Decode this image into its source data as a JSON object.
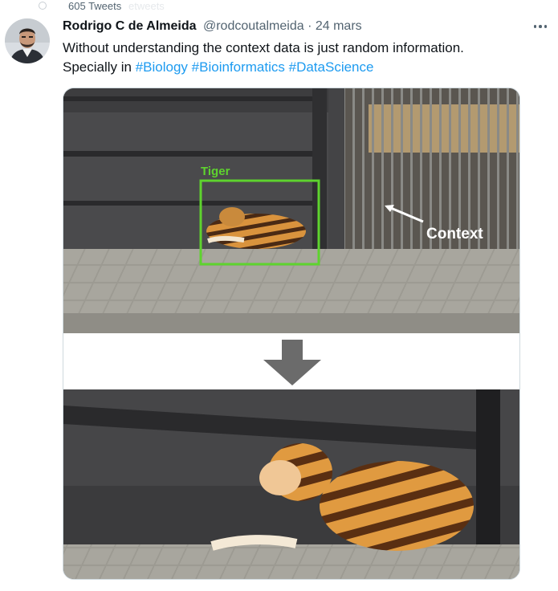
{
  "top_bar": {
    "tweet_count": "605 Tweets",
    "ghost_text": "etweets"
  },
  "tweet": {
    "author": {
      "display_name": "Rodrigo C de Almeida",
      "handle": "@rodcoutalmeida",
      "separator": "·",
      "timestamp": "24 mars",
      "avatar_icon": "profile-photo"
    },
    "more_icon": "ellipsis-icon",
    "text_line1": "Without understanding the context data is just random information.",
    "text_line2_prefix": "Specially in ",
    "hashtags": [
      "#Biology",
      "#Bioinformatics",
      "#DataScience"
    ],
    "media": {
      "label_tiger": "Tiger",
      "label_context": "Context",
      "arrow_icon": "down-arrow-icon",
      "colors": {
        "label_tiger": "#5ed32e",
        "label_context": "#ffffff",
        "arrow": "#6b6b6b"
      }
    }
  },
  "colors": {
    "link": "#1d9bf0",
    "secondary_text": "#536471",
    "primary_text": "#0f1419"
  }
}
